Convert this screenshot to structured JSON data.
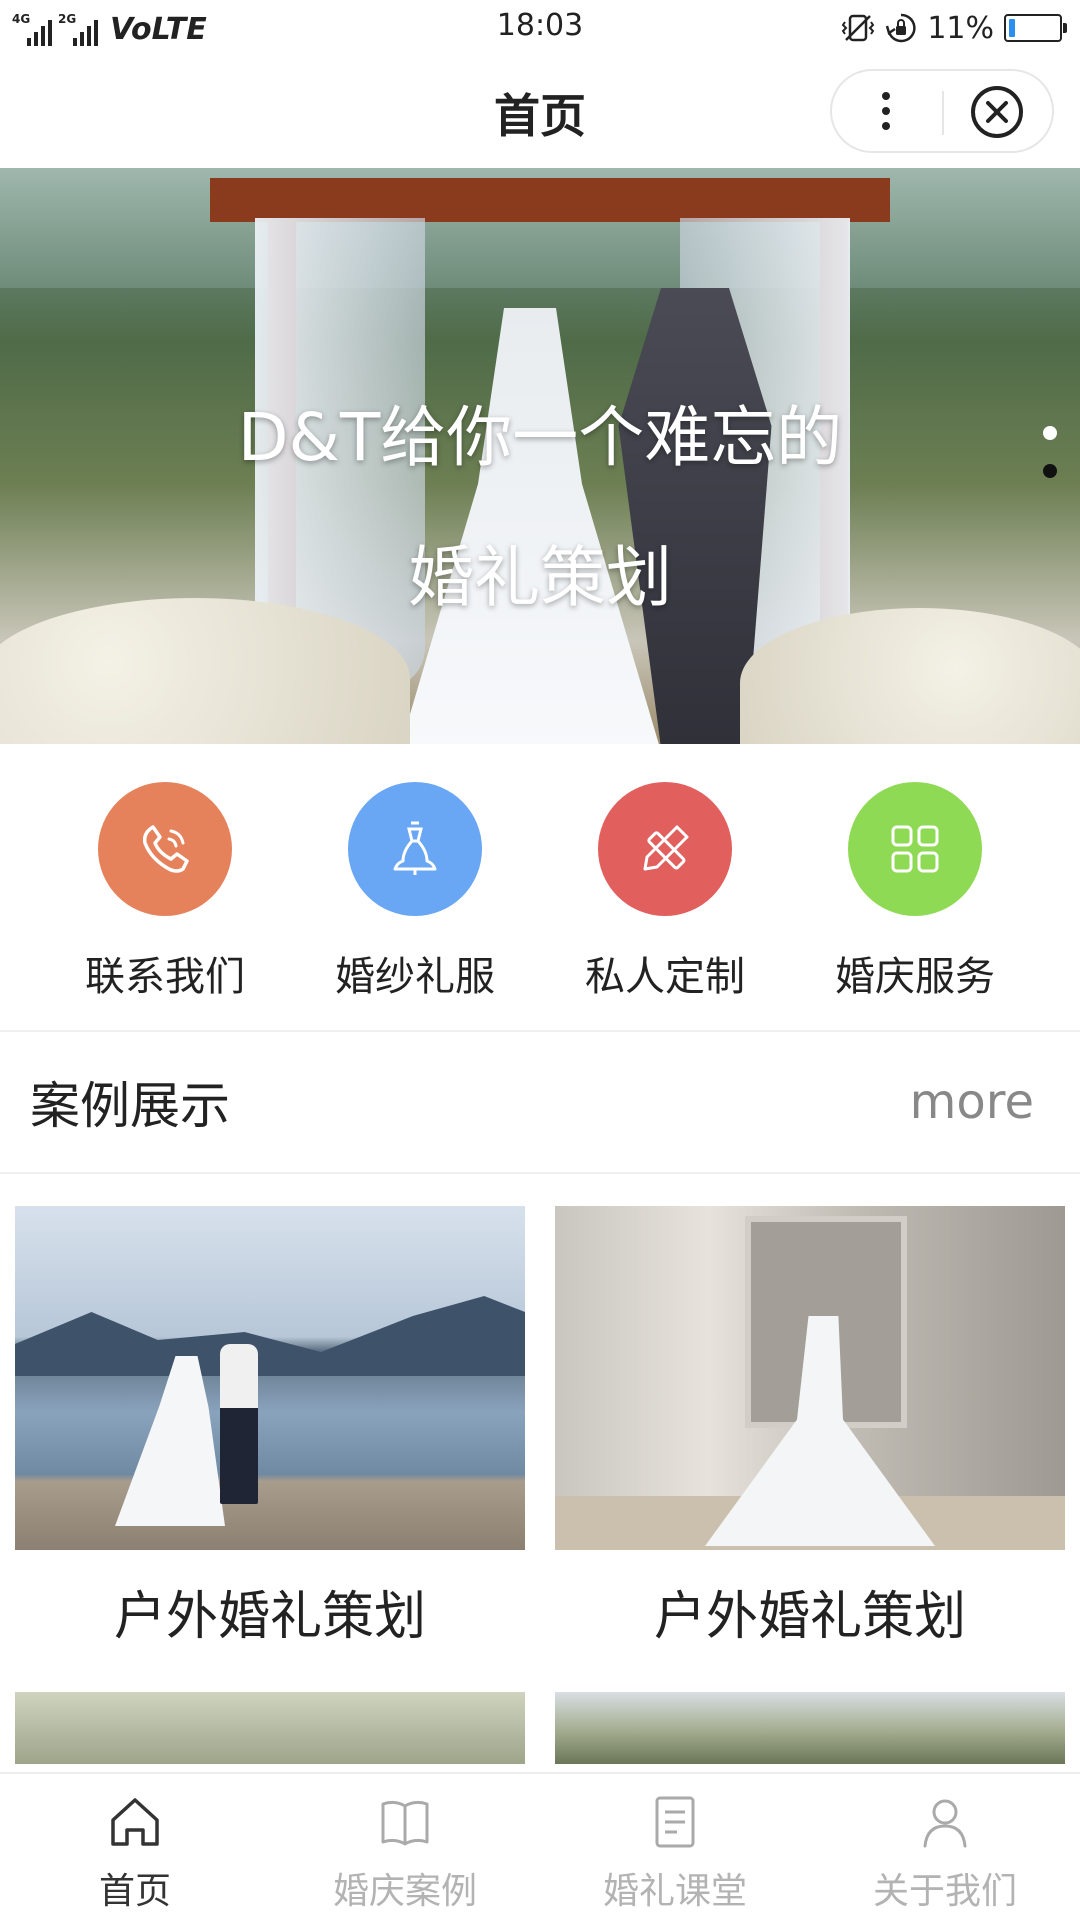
{
  "status_bar": {
    "sim1_tag": "4G",
    "sim2_tag": "2G",
    "network": "VoLTE",
    "time": "18:03",
    "battery_percent": "11%",
    "battery_level": 0.11,
    "icons": [
      "vibrate-icon",
      "rotation-lock-icon"
    ]
  },
  "nav": {
    "title": "首页",
    "menu_icon": "more-dots-icon",
    "close_icon": "close-circle-icon"
  },
  "banner": {
    "title_line1": "D&T给你一个难忘的",
    "title_line2": "婚礼策划",
    "slides": 2,
    "active_slide": 1
  },
  "quick_nav": [
    {
      "label": "联系我们",
      "icon": "phone-icon",
      "color": "#E5825C"
    },
    {
      "label": "婚纱礼服",
      "icon": "wedding-dress-icon",
      "color": "#69A6F4"
    },
    {
      "label": "私人定制",
      "icon": "pencil-ruler-icon",
      "color": "#E1605E"
    },
    {
      "label": "婚庆服务",
      "icon": "grid-icon",
      "color": "#8FDA55"
    }
  ],
  "cases_section": {
    "title": "案例展示",
    "more_label": "more"
  },
  "cases": [
    {
      "title": "户外婚礼策划"
    },
    {
      "title": "户外婚礼策划"
    }
  ],
  "tab_bar": {
    "active_color": "#333333",
    "inactive_color": "#B3B3B3",
    "items": [
      {
        "label": "首页",
        "icon": "home-icon",
        "active": true
      },
      {
        "label": "婚庆案例",
        "icon": "book-icon",
        "active": false
      },
      {
        "label": "婚礼课堂",
        "icon": "document-icon",
        "active": false
      },
      {
        "label": "关于我们",
        "icon": "user-icon",
        "active": false
      }
    ]
  }
}
